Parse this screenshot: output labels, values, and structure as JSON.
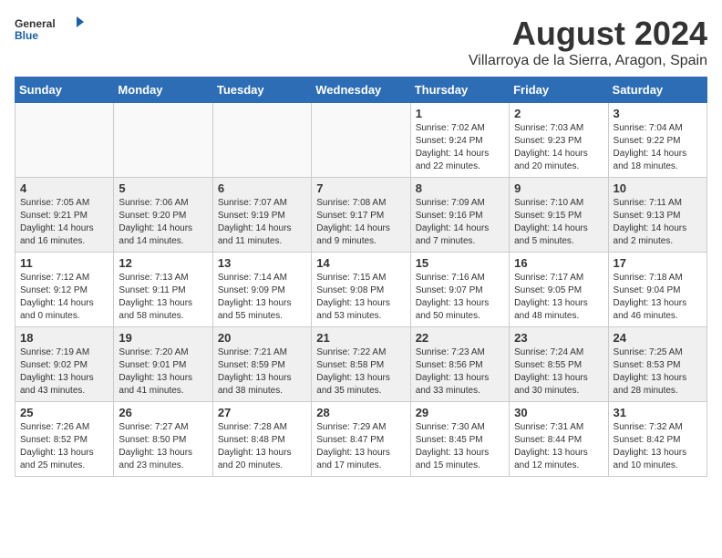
{
  "header": {
    "logo_general": "General",
    "logo_blue": "Blue",
    "month_year": "August 2024",
    "location": "Villarroya de la Sierra, Aragon, Spain"
  },
  "days_of_week": [
    "Sunday",
    "Monday",
    "Tuesday",
    "Wednesday",
    "Thursday",
    "Friday",
    "Saturday"
  ],
  "weeks": [
    [
      {
        "day": "",
        "info": ""
      },
      {
        "day": "",
        "info": ""
      },
      {
        "day": "",
        "info": ""
      },
      {
        "day": "",
        "info": ""
      },
      {
        "day": "1",
        "info": "Sunrise: 7:02 AM\nSunset: 9:24 PM\nDaylight: 14 hours\nand 22 minutes."
      },
      {
        "day": "2",
        "info": "Sunrise: 7:03 AM\nSunset: 9:23 PM\nDaylight: 14 hours\nand 20 minutes."
      },
      {
        "day": "3",
        "info": "Sunrise: 7:04 AM\nSunset: 9:22 PM\nDaylight: 14 hours\nand 18 minutes."
      }
    ],
    [
      {
        "day": "4",
        "info": "Sunrise: 7:05 AM\nSunset: 9:21 PM\nDaylight: 14 hours\nand 16 minutes."
      },
      {
        "day": "5",
        "info": "Sunrise: 7:06 AM\nSunset: 9:20 PM\nDaylight: 14 hours\nand 14 minutes."
      },
      {
        "day": "6",
        "info": "Sunrise: 7:07 AM\nSunset: 9:19 PM\nDaylight: 14 hours\nand 11 minutes."
      },
      {
        "day": "7",
        "info": "Sunrise: 7:08 AM\nSunset: 9:17 PM\nDaylight: 14 hours\nand 9 minutes."
      },
      {
        "day": "8",
        "info": "Sunrise: 7:09 AM\nSunset: 9:16 PM\nDaylight: 14 hours\nand 7 minutes."
      },
      {
        "day": "9",
        "info": "Sunrise: 7:10 AM\nSunset: 9:15 PM\nDaylight: 14 hours\nand 5 minutes."
      },
      {
        "day": "10",
        "info": "Sunrise: 7:11 AM\nSunset: 9:13 PM\nDaylight: 14 hours\nand 2 minutes."
      }
    ],
    [
      {
        "day": "11",
        "info": "Sunrise: 7:12 AM\nSunset: 9:12 PM\nDaylight: 14 hours\nand 0 minutes."
      },
      {
        "day": "12",
        "info": "Sunrise: 7:13 AM\nSunset: 9:11 PM\nDaylight: 13 hours\nand 58 minutes."
      },
      {
        "day": "13",
        "info": "Sunrise: 7:14 AM\nSunset: 9:09 PM\nDaylight: 13 hours\nand 55 minutes."
      },
      {
        "day": "14",
        "info": "Sunrise: 7:15 AM\nSunset: 9:08 PM\nDaylight: 13 hours\nand 53 minutes."
      },
      {
        "day": "15",
        "info": "Sunrise: 7:16 AM\nSunset: 9:07 PM\nDaylight: 13 hours\nand 50 minutes."
      },
      {
        "day": "16",
        "info": "Sunrise: 7:17 AM\nSunset: 9:05 PM\nDaylight: 13 hours\nand 48 minutes."
      },
      {
        "day": "17",
        "info": "Sunrise: 7:18 AM\nSunset: 9:04 PM\nDaylight: 13 hours\nand 46 minutes."
      }
    ],
    [
      {
        "day": "18",
        "info": "Sunrise: 7:19 AM\nSunset: 9:02 PM\nDaylight: 13 hours\nand 43 minutes."
      },
      {
        "day": "19",
        "info": "Sunrise: 7:20 AM\nSunset: 9:01 PM\nDaylight: 13 hours\nand 41 minutes."
      },
      {
        "day": "20",
        "info": "Sunrise: 7:21 AM\nSunset: 8:59 PM\nDaylight: 13 hours\nand 38 minutes."
      },
      {
        "day": "21",
        "info": "Sunrise: 7:22 AM\nSunset: 8:58 PM\nDaylight: 13 hours\nand 35 minutes."
      },
      {
        "day": "22",
        "info": "Sunrise: 7:23 AM\nSunset: 8:56 PM\nDaylight: 13 hours\nand 33 minutes."
      },
      {
        "day": "23",
        "info": "Sunrise: 7:24 AM\nSunset: 8:55 PM\nDaylight: 13 hours\nand 30 minutes."
      },
      {
        "day": "24",
        "info": "Sunrise: 7:25 AM\nSunset: 8:53 PM\nDaylight: 13 hours\nand 28 minutes."
      }
    ],
    [
      {
        "day": "25",
        "info": "Sunrise: 7:26 AM\nSunset: 8:52 PM\nDaylight: 13 hours\nand 25 minutes."
      },
      {
        "day": "26",
        "info": "Sunrise: 7:27 AM\nSunset: 8:50 PM\nDaylight: 13 hours\nand 23 minutes."
      },
      {
        "day": "27",
        "info": "Sunrise: 7:28 AM\nSunset: 8:48 PM\nDaylight: 13 hours\nand 20 minutes."
      },
      {
        "day": "28",
        "info": "Sunrise: 7:29 AM\nSunset: 8:47 PM\nDaylight: 13 hours\nand 17 minutes."
      },
      {
        "day": "29",
        "info": "Sunrise: 7:30 AM\nSunset: 8:45 PM\nDaylight: 13 hours\nand 15 minutes."
      },
      {
        "day": "30",
        "info": "Sunrise: 7:31 AM\nSunset: 8:44 PM\nDaylight: 13 hours\nand 12 minutes."
      },
      {
        "day": "31",
        "info": "Sunrise: 7:32 AM\nSunset: 8:42 PM\nDaylight: 13 hours\nand 10 minutes."
      }
    ]
  ]
}
